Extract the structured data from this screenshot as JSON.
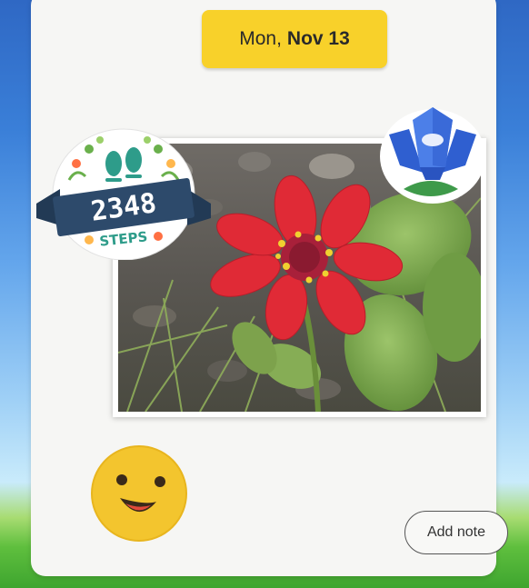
{
  "date": {
    "weekday": "Mon,",
    "month_day": "Nov 13"
  },
  "steps_sticker": {
    "count": "2348",
    "label": "STEPS"
  },
  "actions": {
    "add_note_label": "Add note"
  },
  "icons": {
    "steps_sticker": "footprints-steps-badge-icon",
    "flower_sticker": "blue-flower-icon",
    "smiley_sticker": "smiley-face-icon"
  },
  "colors": {
    "date_badge": "#f8d12a",
    "card": "#f6f6f4",
    "steps_banner": "#2d4a6b",
    "flower": "#3b6fe0"
  }
}
